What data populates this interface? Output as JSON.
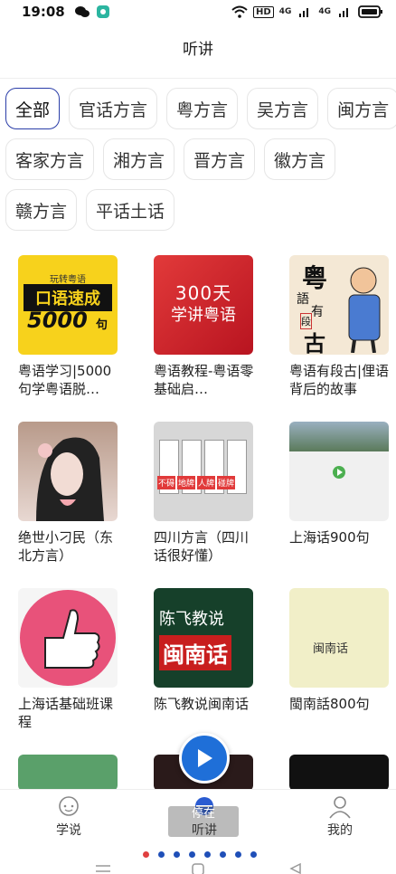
{
  "status_bar": {
    "time": "19:08",
    "network_label": "HD",
    "signal_labels": [
      "4G",
      "4G"
    ]
  },
  "header": {
    "title": "听讲"
  },
  "chips": [
    [
      {
        "label": "全部",
        "active": true
      },
      {
        "label": "官话方言"
      },
      {
        "label": "粤方言"
      },
      {
        "label": "吴方言"
      },
      {
        "label": "闽方言"
      }
    ],
    [
      {
        "label": "客家方言"
      },
      {
        "label": "湘方言"
      },
      {
        "label": "晋方言"
      },
      {
        "label": "徽方言"
      }
    ],
    [
      {
        "label": "赣方言"
      },
      {
        "label": "平话土话"
      }
    ]
  ],
  "cards": [
    {
      "title": "粤语学习|5000句学粤语脱…",
      "cover_texts": [
        "玩转粤语",
        "口语速成",
        "5000",
        "句"
      ]
    },
    {
      "title": "粤语教程-粤语零基础启…",
      "cover_texts": [
        "300天",
        "学讲粤语"
      ]
    },
    {
      "title": "粤语有段古|俚语背后的故事",
      "cover_texts": [
        "粤",
        "語",
        "有",
        "段",
        "古"
      ]
    },
    {
      "title": "绝世小刁民（东北方言）",
      "cover_texts": []
    },
    {
      "title": "四川方言（四川话很好懂）",
      "cover_texts": [
        "不碍",
        "地牌",
        "人牌",
        "碰牌"
      ]
    },
    {
      "title": "上海话900句",
      "cover_texts": []
    },
    {
      "title": "上海话基础班课程",
      "cover_texts": []
    },
    {
      "title": "陈飞教说闽南话",
      "cover_texts": [
        "陈飞教说",
        "闽南话"
      ]
    },
    {
      "title": "閩南話800句",
      "cover_texts": [
        "闽南话"
      ]
    },
    {
      "title": "",
      "cover_texts": []
    },
    {
      "title": "",
      "cover_texts": []
    },
    {
      "title": "",
      "cover_texts": []
    }
  ],
  "tabbar": [
    {
      "label": "学说",
      "icon": "chat-bubble-icon"
    },
    {
      "label": "听讲",
      "icon": "ear-icon",
      "overlay_label": "停在"
    },
    {
      "label": "我的",
      "icon": "person-icon"
    }
  ],
  "pager": {
    "count": 8,
    "active_index": 0
  },
  "colors": {
    "accent": "#2a3da8",
    "play": "#1f6fd8"
  }
}
